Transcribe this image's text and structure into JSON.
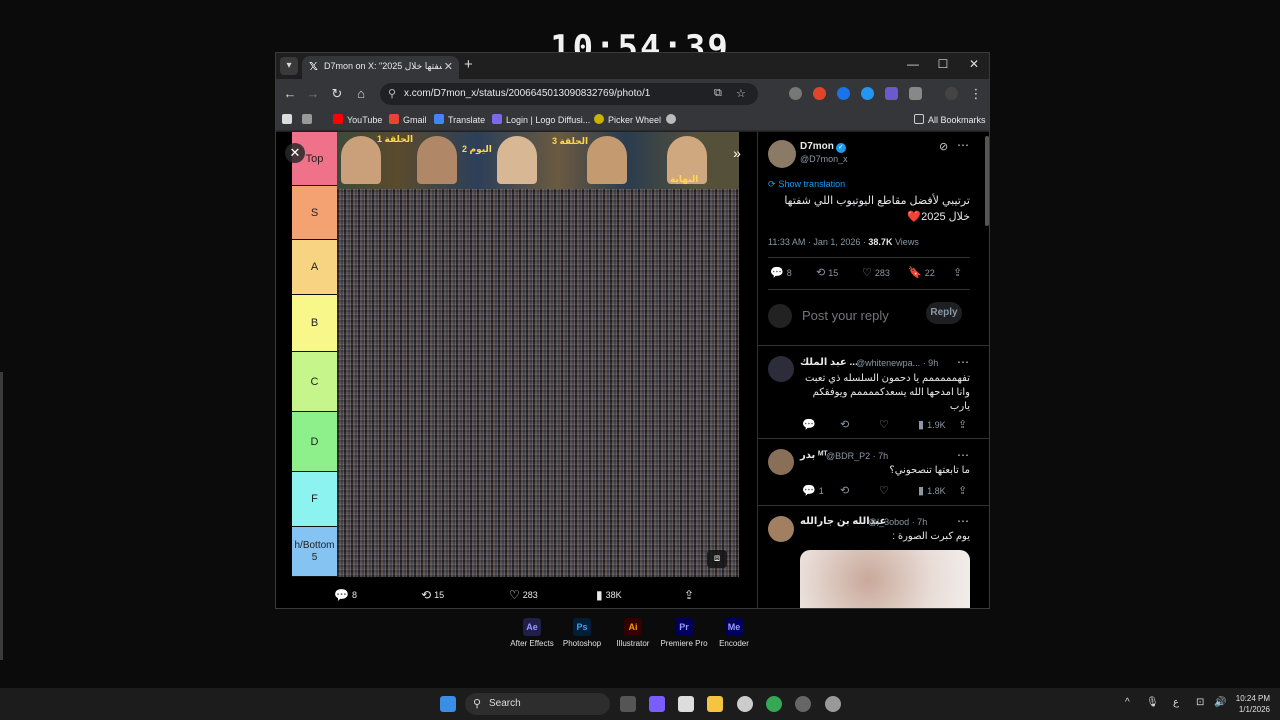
{
  "overlay_clock": "10:54:39",
  "browser": {
    "tab_title": "D7mon on X: \"2025 شفتها خلال",
    "url": "x.com/D7mon_x/status/2006645013090832769/photo/1",
    "bookmarks": [
      "YouTube",
      "Gmail",
      "Translate",
      "Login | Logo Diffusi...",
      "Picker Wheel"
    ],
    "all_bookmarks": "All Bookmarks"
  },
  "media": {
    "tiers": [
      {
        "label": "Top",
        "color": "#f0718a"
      },
      {
        "label": "S",
        "color": "#f4a271"
      },
      {
        "label": "A",
        "color": "#f7d482"
      },
      {
        "label": "B",
        "color": "#f7f78a"
      },
      {
        "label": "C",
        "color": "#c6f58c"
      },
      {
        "label": "D",
        "color": "#8ef08a"
      },
      {
        "label": "F",
        "color": "#8cf3f1"
      },
      {
        "label": "h/Bottom 5",
        "color": "#85c3f3"
      }
    ],
    "thumb_captions": [
      "الحلقة 1",
      "اليوم 2",
      "الحلقة 3",
      "النهاية"
    ],
    "actions": {
      "replies": "8",
      "reposts": "15",
      "likes": "283",
      "views": "38K"
    }
  },
  "tweet": {
    "author_name": "D7mon",
    "author_handle": "@D7mon_x",
    "show_translation": "Show translation",
    "text": "ترتيبي لأفضل مقاطع اليوتيوب اللي شفتها خلال 2025❤️",
    "timestamp": "11:33 AM · Jan 1, 2026 ·",
    "views_count": "38.7K",
    "views_label": "Views",
    "stats": {
      "replies": "8",
      "reposts": "15",
      "likes": "283",
      "bookmarks": "22"
    },
    "reply_placeholder": "Post your reply",
    "reply_button": "Reply"
  },
  "replies": [
    {
      "name": "عبد الملك ...",
      "handle": "@whitenewpa...",
      "time": "· 9h",
      "text": "تفهمممممم يا دحمون السلسله ذي تعبت وانا امدحها الله يسعدكممممم ويوفقكم يارب",
      "views": "1.9K"
    },
    {
      "name": "بدر ᴹᵀ",
      "handle": "@BDR_P2",
      "time": "· 7h",
      "text": "ما تابعتها تنصحوني؟",
      "replies": "1",
      "views": "1.8K"
    },
    {
      "name": "عبدالله بن جارالله",
      "handle": "@l_3obod",
      "time": "· 7h",
      "text": "يوم كبرت الصورة :"
    }
  ],
  "dock_apps": [
    {
      "abbr": "Ae",
      "label": "After Effects",
      "color": "#9999ff",
      "bg": "#1f1f4a"
    },
    {
      "abbr": "Ps",
      "label": "Photoshop",
      "color": "#31a8ff",
      "bg": "#001e36"
    },
    {
      "abbr": "Ai",
      "label": "Illustrator",
      "color": "#ff9a00",
      "bg": "#330000"
    },
    {
      "abbr": "Pr",
      "label": "Premiere Pro",
      "color": "#9999ff",
      "bg": "#00005b"
    },
    {
      "abbr": "Me",
      "label": "Encoder",
      "color": "#9999ff",
      "bg": "#00005b"
    }
  ],
  "taskbar": {
    "search": "Search",
    "lang": "ع",
    "time": "10:24 PM",
    "date": "1/1/2026"
  }
}
